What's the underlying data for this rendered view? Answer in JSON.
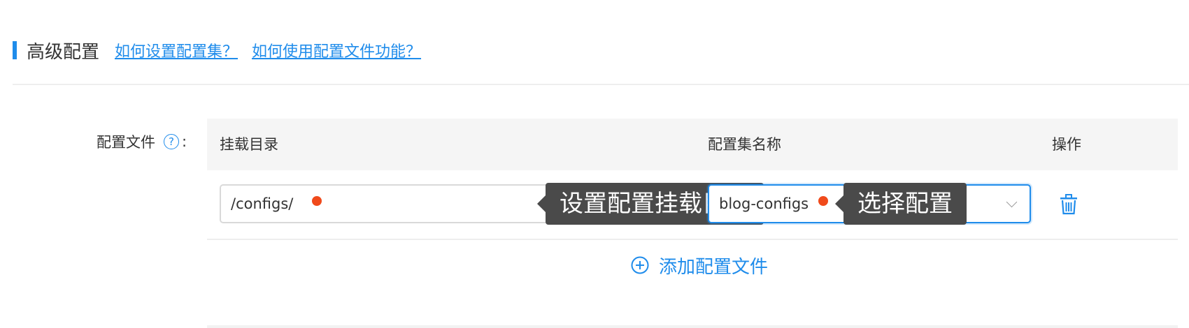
{
  "section": {
    "title": "高级配置",
    "links": [
      "如何设置配置集？",
      "如何使用配置文件功能？"
    ]
  },
  "field": {
    "label": "配置文件",
    "help_icon": "question-circle-icon",
    "colon": ":"
  },
  "table": {
    "columns": [
      "挂载目录",
      "配置集名称",
      "操作"
    ],
    "rows": [
      {
        "mount_path": "/configs/",
        "mount_tooltip": "设置配置挂载目录",
        "config_name": "blog-configs",
        "config_tooltip": "选择配置",
        "action_icon": "trash-icon"
      }
    ],
    "add_label": "添加配置文件",
    "add_icon": "plus-circle-icon"
  },
  "colors": {
    "accent": "#1f8ceb",
    "marker": "#f04a1b",
    "tooltip_bg": "#4a4a4a"
  }
}
